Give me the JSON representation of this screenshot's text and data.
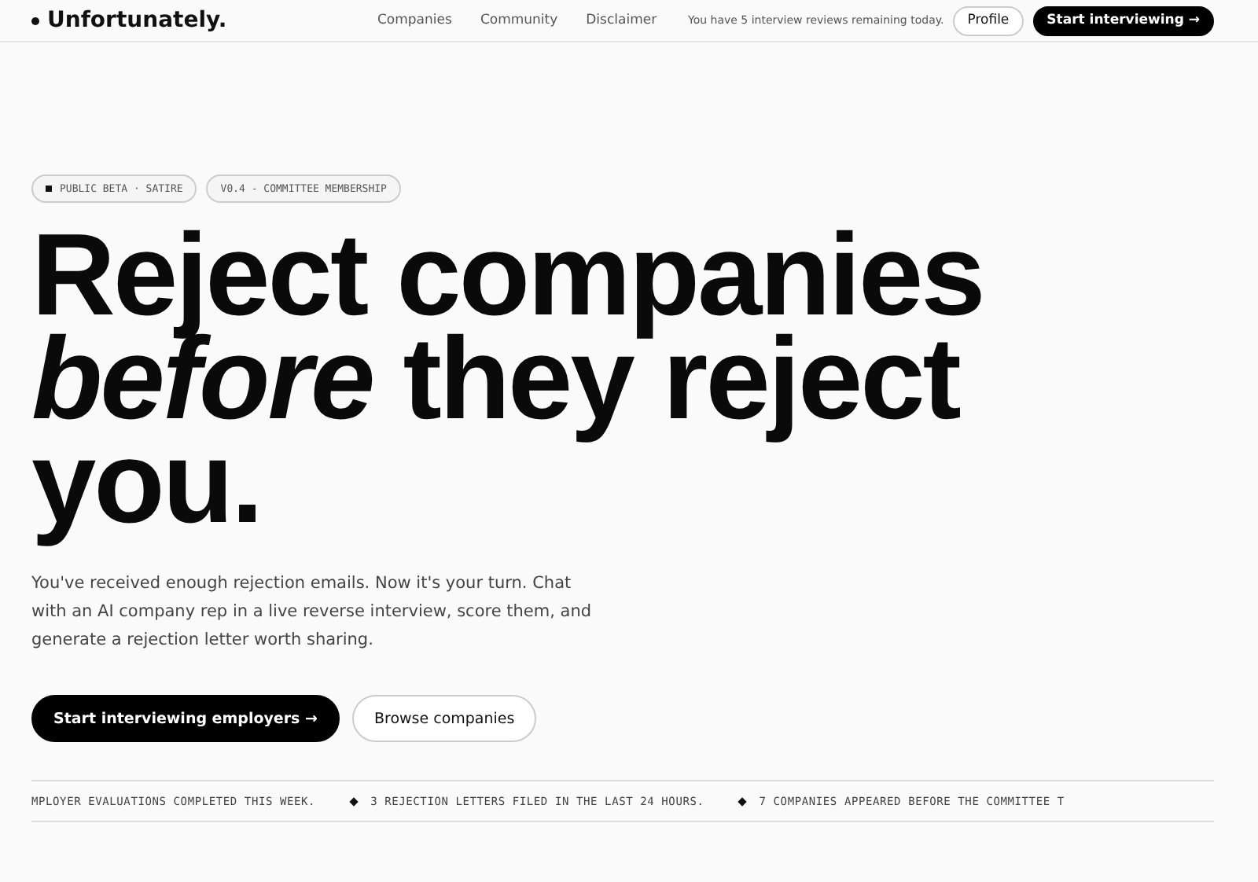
{
  "nav": {
    "brand": "Unfortunately.",
    "links": [
      "Companies",
      "Community",
      "Disclaimer"
    ],
    "quota": "You have 5 interview reviews remaining today.",
    "profile_button": "Profile",
    "cta_button": "Start interviewing →"
  },
  "badges": [
    {
      "label": "PUBLIC BETA · SATIRE",
      "dot": true
    },
    {
      "label": "V0.4 - COMMITTEE MEMBERSHIP",
      "dot": false
    }
  ],
  "headline": [
    "Reject companies",
    "*before* they reject",
    "you."
  ],
  "intro": "You've received enough rejection emails. Now it's your turn. Chat with an AI company rep in a live reverse interview, score them, and generate a rejection letter worth sharing.",
  "buttons": [
    {
      "label": "Start interviewing employers →",
      "kind": "primary"
    },
    {
      "label": "Browse companies",
      "kind": "secondary"
    }
  ],
  "ticker": [
    "MPLOYER EVALUATIONS COMPLETED THIS WEEK.",
    "3 REJECTION LETTERS FILED IN THE LAST 24 HOURS.",
    "7 COMPANIES APPEARED BEFORE THE COMMITTEE T"
  ]
}
